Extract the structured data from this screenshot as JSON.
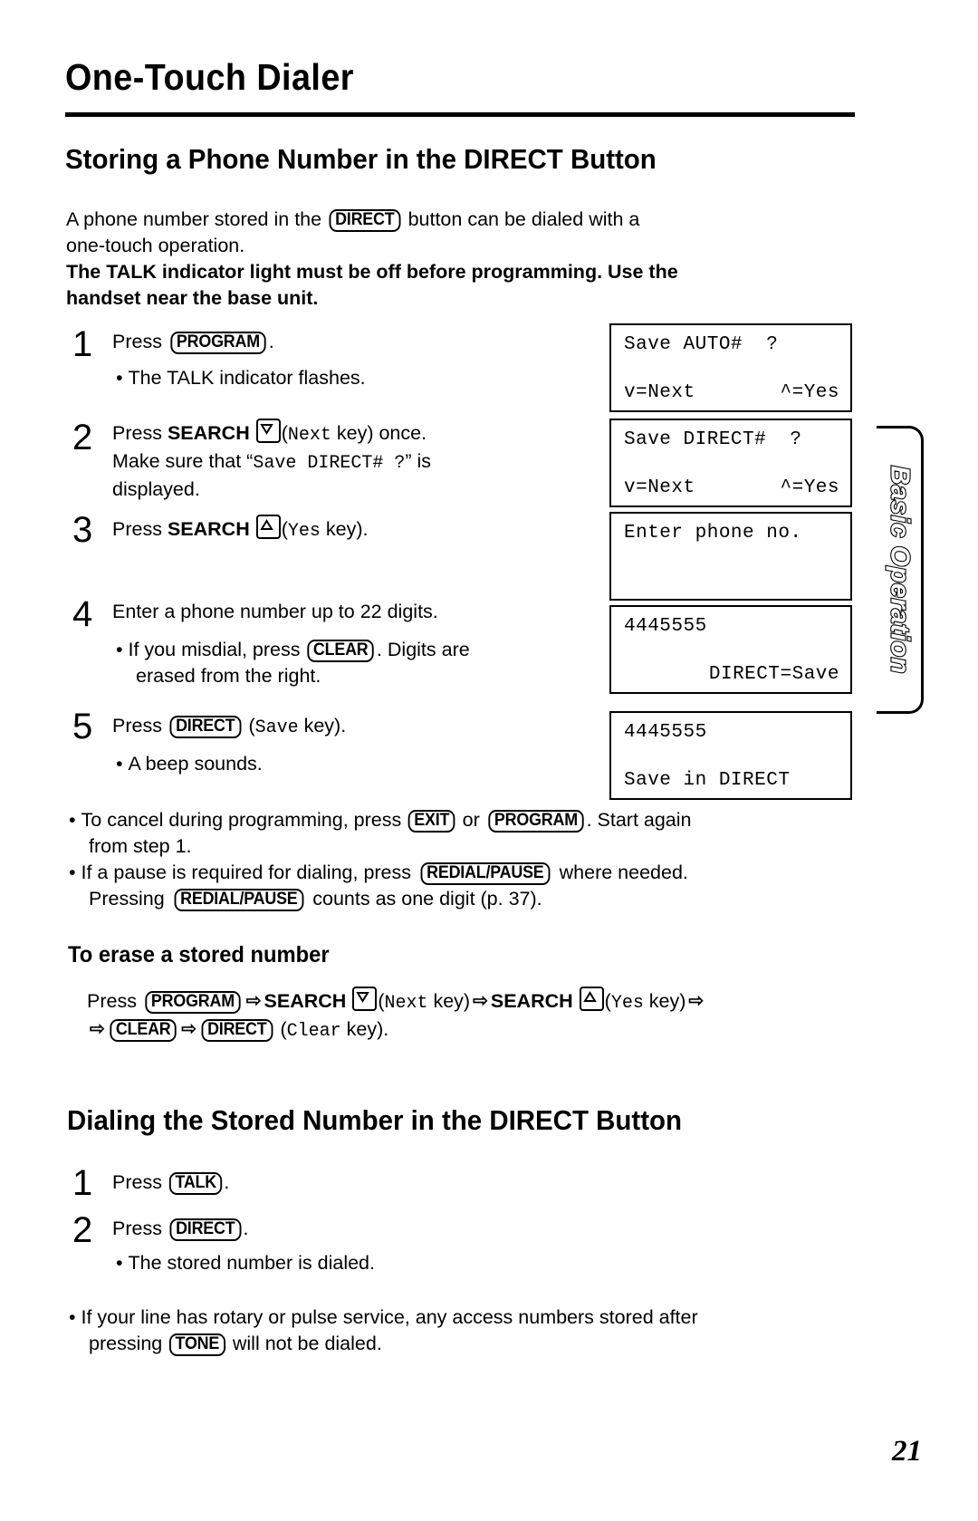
{
  "chapter": {
    "title": "One-Touch Dialer"
  },
  "side_tab": {
    "label": "Basic Operation"
  },
  "section1": {
    "heading": "Storing a Phone Number in the DIRECT Button",
    "intro": {
      "line1_before": "A phone number stored in the ",
      "key": "DIRECT",
      "line1_after": " button can be dialed with a",
      "line2": "one-touch operation.",
      "bold_line1": "The TALK indicator light must be off before programming. Use the",
      "bold_line2": "handset near the base unit."
    },
    "steps": [
      {
        "num": "1",
        "text_before": "Press ",
        "key": "PROGRAM",
        "text_after": ".",
        "bullets": [
          "The TALK indicator flashes."
        ]
      },
      {
        "num": "2",
        "text_before": "Press ",
        "label_bold": "SEARCH",
        "key_glyph": "chevron-down-key",
        "mono_word": "Next",
        "text_after": " key) once.",
        "line2_a": "Make sure that “",
        "line2_mono": "Save DIRECT#  ?",
        "line2_b": "” is",
        "line3": "displayed.",
        "bullets": []
      },
      {
        "num": "3",
        "text_before": "Press ",
        "label_bold": "SEARCH",
        "key_glyph": "chevron-up-key",
        "mono_word": "Yes",
        "text_after": " key).",
        "bullets": []
      },
      {
        "num": "4",
        "text": "Enter a phone number up to 22 digits.",
        "bullet_before": "If you misdial, press ",
        "bullet_key": "CLEAR",
        "bullet_after": ". Digits are",
        "bullet_line2": "erased from the right."
      },
      {
        "num": "5",
        "text_before": "Press ",
        "key": "DIRECT",
        "mono_word": "Save",
        "text_after": " key).",
        "bullets": [
          "A beep sounds."
        ]
      }
    ],
    "displays": [
      {
        "line1": "Save AUTO#  ?",
        "line2": "v=Next",
        "line2_right": "^=Yes"
      },
      {
        "line1": "Save DIRECT#  ?",
        "line2": "v=Next",
        "line2_right": "^=Yes"
      },
      {
        "line1": "Enter phone no.",
        "line2": "",
        "line2_right": ""
      },
      {
        "line1": "4445555",
        "line2": "",
        "line2_right": "DIRECT=Save"
      },
      {
        "line1": "4445555",
        "line2": "Save in DIRECT",
        "line2_right": ""
      }
    ],
    "notes": [
      {
        "a": "To cancel during programming, press ",
        "key1": "EXIT",
        "b": " or ",
        "key2": "PROGRAM",
        "c": ". Start again",
        "line2": "from step 1."
      },
      {
        "a": "If a pause is required for dialing, press ",
        "key1": "REDIAL/PAUSE",
        "b": " where needed.",
        "line2_a": "Pressing ",
        "line2_key": "REDIAL/PAUSE",
        "line2_b": " counts as one digit (p. 37)."
      }
    ]
  },
  "erase": {
    "heading": "To erase a stored number",
    "line1": {
      "press": "Press ",
      "key1": "PROGRAM",
      "arrow": "⇨",
      "search1": "SEARCH",
      "next_word": "Next",
      "next_suffix": " key)",
      "search2": "SEARCH",
      "yes_word": "Yes",
      "yes_suffix": " key)"
    },
    "line2": {
      "key_clear": "CLEAR",
      "key_direct": "DIRECT",
      "clear_word": "Clear",
      "suffix": " key)."
    }
  },
  "section2": {
    "heading": "Dialing the Stored Number in the DIRECT Button",
    "steps": [
      {
        "num": "1",
        "text_before": "Press ",
        "key": "TALK",
        "text_after": ".",
        "bullets": []
      },
      {
        "num": "2",
        "text_before": "Press ",
        "key": "DIRECT",
        "text_after": ".",
        "bullets": [
          "The stored number is dialed."
        ]
      }
    ],
    "note": {
      "a": "If your line has rotary or pulse service, any access numbers stored after",
      "line2_a": "pressing ",
      "line2_key": "TONE",
      "line2_b": " will not be dialed."
    }
  },
  "footer": {
    "page_number": "21"
  }
}
